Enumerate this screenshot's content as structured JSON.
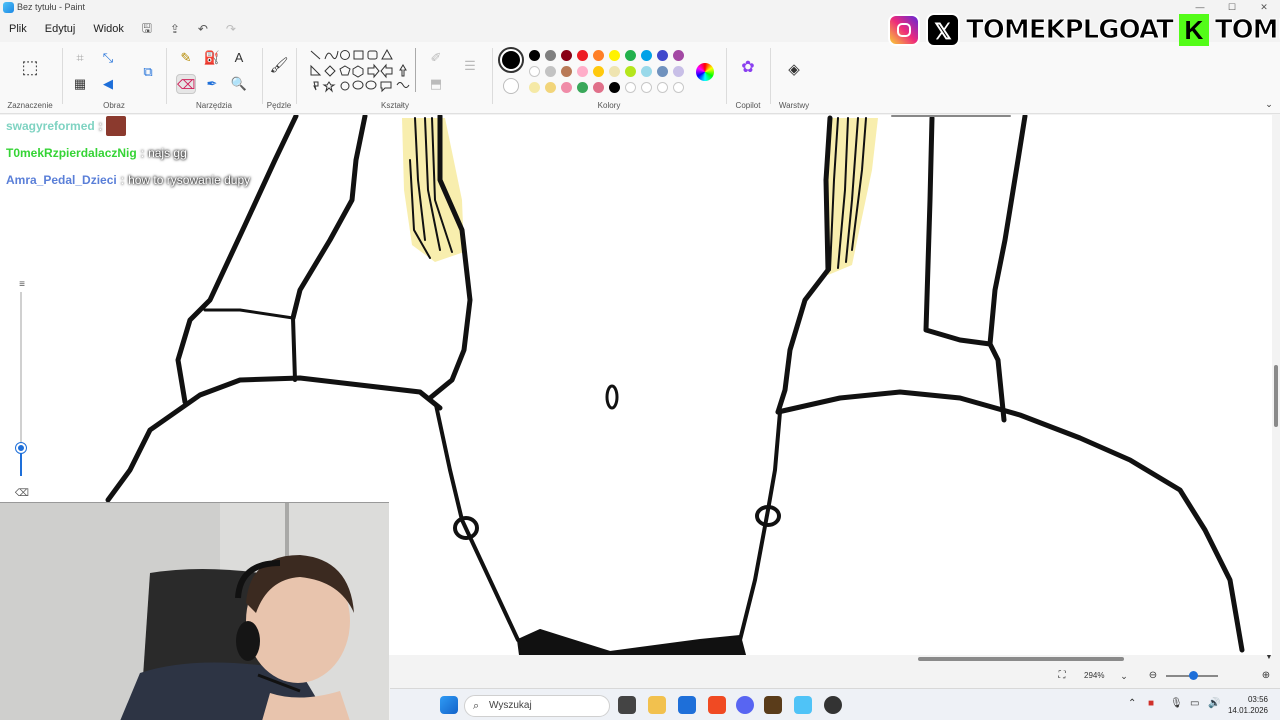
{
  "window": {
    "title": "Bez tytułu - Paint",
    "controls": [
      "—",
      "☐",
      "✕"
    ]
  },
  "menu": {
    "file": "Plik",
    "edit": "Edytuj",
    "view": "Widok"
  },
  "ribbon": {
    "groups": {
      "selection": "Zaznaczenie",
      "image": "Obraz",
      "tools": "Narzędzia",
      "brushes": "Pędzle",
      "shapes": "Kształty",
      "colors": "Kolory",
      "copilot": "Copilot",
      "layers": "Warstwy"
    },
    "active_tool": "eraser",
    "primary_color": "#000000",
    "secondary_color": "#ffffff",
    "palette_row1": [
      "#000000",
      "#7f7f7f",
      "#880015",
      "#ed1c24",
      "#ff7f27",
      "#fff200",
      "#22b14c",
      "#00a2e8",
      "#3f48cc",
      "#a349a4"
    ],
    "palette_row2": [
      "#ffffff",
      "#c3c3c3",
      "#b97a57",
      "#ffaec9",
      "#ffc90e",
      "#efe4b0",
      "#b5e61d",
      "#99d9ea",
      "#7092be",
      "#c8bfe7"
    ],
    "palette_row3": [
      "#f5e9a6",
      "#f2d57a",
      "#f08ca8",
      "#3aa85a",
      "#e0708a",
      "#000000",
      "",
      "",
      "",
      ""
    ]
  },
  "overlay": {
    "social_handle_1": "TOMEKPLGOAT",
    "social_handle_2": "TOMEKPL",
    "chat": [
      {
        "user": "swagyreformed",
        "sep": ":",
        "msg": "",
        "color": "#7fd3c2",
        "emote": true
      },
      {
        "user": "T0mekRzpierdalaczNig",
        "sep": ":",
        "msg": "najs gg",
        "color": "#35d435",
        "emote": false
      },
      {
        "user": "Amra_Pedal_Dzieci",
        "sep": ":",
        "msg": "how to rysowanie dupy",
        "color": "#5a7fd8",
        "emote": false
      }
    ]
  },
  "statusbar": {
    "zoom": "294%"
  },
  "taskbar": {
    "search_placeholder": "Wyszukaj",
    "time": "03:56",
    "date": "14.01.2026"
  }
}
